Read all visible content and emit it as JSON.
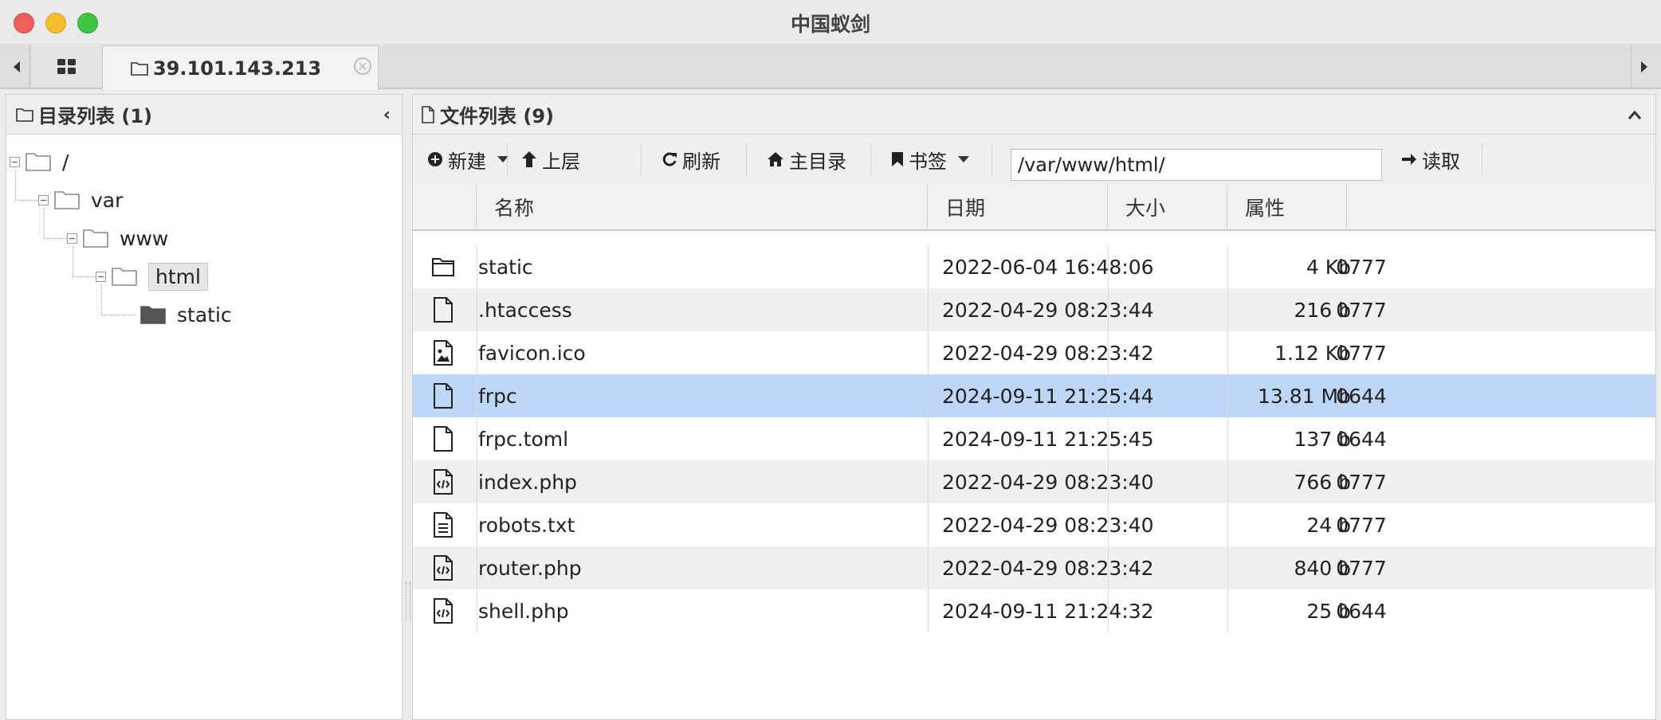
{
  "window": {
    "title": "中国蚁剑"
  },
  "tabs": {
    "host_tab_label": "39.101.143.213",
    "close_symbol": "✕"
  },
  "left_panel": {
    "title": "目录列表 (1)",
    "tree": [
      {
        "label": "/",
        "level": 0
      },
      {
        "label": "var",
        "level": 1
      },
      {
        "label": "www",
        "level": 2
      },
      {
        "label": "html",
        "level": 3,
        "selected": true
      },
      {
        "label": "static",
        "level": 4,
        "filled": true
      }
    ]
  },
  "right_panel": {
    "title": "文件列表 (9)",
    "toolbar": {
      "new_label": "新建",
      "up_label": "上层",
      "refresh_label": "刷新",
      "home_label": "主目录",
      "bookmark_label": "书签",
      "path_value": "/var/www/html/",
      "read_label": "读取"
    },
    "columns": {
      "name": "名称",
      "date": "日期",
      "size": "大小",
      "attr": "属性"
    },
    "files": [
      {
        "icon": "folder-icon",
        "name": "static",
        "date": "2022-06-04 16:48:06",
        "size": "4 Kb",
        "attr": "0777"
      },
      {
        "icon": "file-icon",
        "name": ".htaccess",
        "date": "2022-04-29 08:23:44",
        "size": "216 b",
        "attr": "0777"
      },
      {
        "icon": "image-file-icon",
        "name": "favicon.ico",
        "date": "2022-04-29 08:23:42",
        "size": "1.12 Kb",
        "attr": "0777"
      },
      {
        "icon": "file-icon",
        "name": "frpc",
        "date": "2024-09-11 21:25:44",
        "size": "13.81 Mb",
        "attr": "0644",
        "selected": true
      },
      {
        "icon": "file-icon",
        "name": "frpc.toml",
        "date": "2024-09-11 21:25:45",
        "size": "137 b",
        "attr": "0644"
      },
      {
        "icon": "code-file-icon",
        "name": "index.php",
        "date": "2022-04-29 08:23:40",
        "size": "766 b",
        "attr": "0777"
      },
      {
        "icon": "text-file-icon",
        "name": "robots.txt",
        "date": "2022-04-29 08:23:40",
        "size": "24 b",
        "attr": "0777"
      },
      {
        "icon": "code-file-icon",
        "name": "router.php",
        "date": "2022-04-29 08:23:42",
        "size": "840 b",
        "attr": "0777"
      },
      {
        "icon": "code-file-icon",
        "name": "shell.php",
        "date": "2024-09-11 21:24:32",
        "size": "25 b",
        "attr": "0644"
      }
    ]
  },
  "colors": {
    "selected_row": "#bed6f8",
    "alt_row": "#f0f0f0",
    "close_light": "#ee5f58",
    "minimize_light": "#f6be2f",
    "maximize_light": "#3ec643"
  }
}
